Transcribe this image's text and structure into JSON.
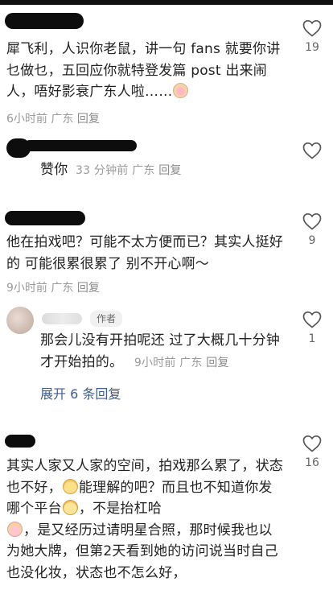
{
  "comments": [
    {
      "text": "犀飞利，人识你老鼠，讲一句 fans 就要你讲乜做乜，五回应你就特登发篇 post 出来闹人，唔好影衰广东人啦……",
      "time": "6小时前",
      "location": "广东",
      "reply_label": "回复",
      "likes": "19",
      "emoji": "crying-face-emoji"
    },
    {
      "text": "赞你",
      "time": "33 分钟前",
      "location": "广东",
      "reply_label": "回复",
      "likes": ""
    },
    {
      "text": "他在拍戏吧？可能不太方便而已？其实人挺好的 可能很累很累了 别不开心啊～",
      "time": "9小时前",
      "location": "广东",
      "reply_label": "回复",
      "likes": "9"
    },
    {
      "badge": "作者",
      "text": "那会儿没有开拍呢还 过了大概几十分钟才开始拍的。",
      "time": "9小时前",
      "location": "广东",
      "reply_label": "回复",
      "likes": "1",
      "expand_label": "展开 6 条回复"
    },
    {
      "text_parts": [
        "其实人家又人家的空间，拍戏那么累了，状态也不好，",
        "能理解的吧？而且也不知道你发哪个平台",
        "，不是抬杠哈",
        "，是又经历过请明星合照，那时候我也以为她大牌，但第2天看到她的访问说当时自己也没化妆，状态也不怎么好，"
      ],
      "likes": "16"
    }
  ],
  "colors": {
    "text": "#222222",
    "meta": "#9b9b9b",
    "link": "#3d5e8c"
  }
}
